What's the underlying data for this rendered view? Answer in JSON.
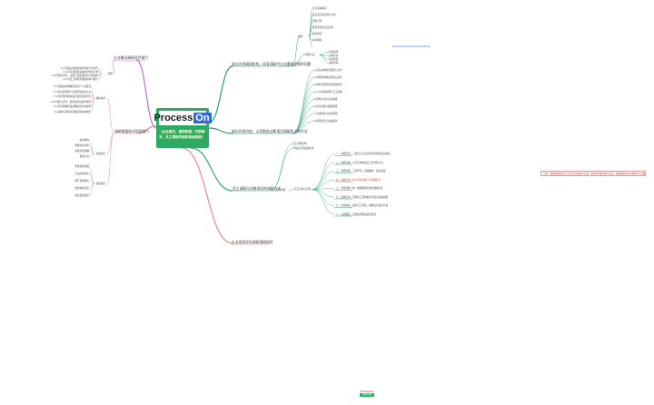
{
  "root": {
    "logo_main": "Process",
    "logo_on": "On",
    "subtitle": "（企业概况、调研数据、内销情况、员工调研风险和落地指南）"
  },
  "branches": [
    {
      "label": "企业概况调研项目指引",
      "color": "#c86ad6"
    },
    {
      "label": "调研数据核对项目指引",
      "color": "#e08a9a"
    },
    {
      "label": "部分外资调研机构，研宣调研中企业重要经营的问题",
      "color": "#2c9a8a"
    },
    {
      "label": "部分外资内控、公司财务诊断项目调研的工作方法",
      "color": "#2c9a8a"
    },
    {
      "label": "员工调研与问卷导问的调研方式",
      "color": "#2eaa67"
    },
    {
      "label": "企业风险评估调研落地指导",
      "color": "#f08a80"
    }
  ],
  "left_groups": [
    {
      "label": "调研",
      "items": [
        "1.公司股东要提供最新有效公司证件",
        "2.公司营业执照副本复印件及公章",
        "3.公司经营业务、主要产品及服务的介绍资料",
        "4.公司近三年财务报表和审计报告"
      ]
    },
    {
      "label": "资料清单",
      "items": [
        "5.公司组织架构图及各部门人员情况",
        "6.公司主要管理人员简历及联系方式",
        "7.公司内部控制制度汇编及流程文件",
        "8.公司重大合同、协议及诉讼案件资料",
        "9.公司近期规划及战略发展方向说明",
        "10.其他与调研项目相关的补充材料"
      ]
    },
    {
      "label": "访谈要点",
      "items": [
        "提前预约",
        "明确访谈对象",
        "准备访谈提纲",
        "现场记录"
      ]
    },
    {
      "label": "调研总结",
      "items": [
        "形成调研底稿",
        "汇总问题清单",
        "撰写调研报告",
        "提交审核意见",
        "落实整改建议"
      ]
    }
  ],
  "upper_right": {
    "groups": [
      {
        "label": "资料",
        "items": [
          "企业基本情况",
          "股东及实际控制人信息",
          "历史沿革",
          "经营范围及主营业务",
          "财务状况",
          "参考网址",
          "http://www.processon.com/mindmap"
        ]
      },
      {
        "label": "调研方法",
        "items": [
          "问卷调查",
          "实地走访",
          "访谈交流",
          "资料查阅"
        ]
      }
    ],
    "middle_items": [
      "1.企业基本情况及核心业务",
      "2.内部控制体系建设与运行",
      "3.财务管理及资金运作情况",
      "4.人力资源管理与员工结构",
      "5.风险识别与应对措施",
      "6.信息系统与数据管理",
      "7.合规经营与法律风险",
      "8.调研结论与改进建议"
    ]
  },
  "lower_right": {
    "pre_items": [
      "员工调研说明",
      "问卷设计及发放安排"
    ],
    "method_label": "问卷调研",
    "sub_label": "员工访谈与问卷",
    "detail_items": [
      "一、调研目的：了解员工对企业经营管理的真实看法",
      "二、调研对象：公司全体在职员工及管理人员",
      "三、调研内容：工作环境、薪酬福利、职业发展",
      "四、调研方式：线上问卷与线下访谈相结合",
      "五、问卷回收：统一收集整理并进行数据分析",
      "六、结果应用：形成员工调研报告并提出改进措施",
      "七、注意事项：保护员工隐私，确保信息真实有效",
      "八、后续跟踪：定期复查整改落实情况"
    ],
    "tip": "注意：调研数据需结合企业实际情况进行分析，避免简单套用统计结论，确保调研报告的客观性与准确性"
  },
  "brand": {
    "top": "ProcessOn",
    "bottom": "思维导图"
  }
}
